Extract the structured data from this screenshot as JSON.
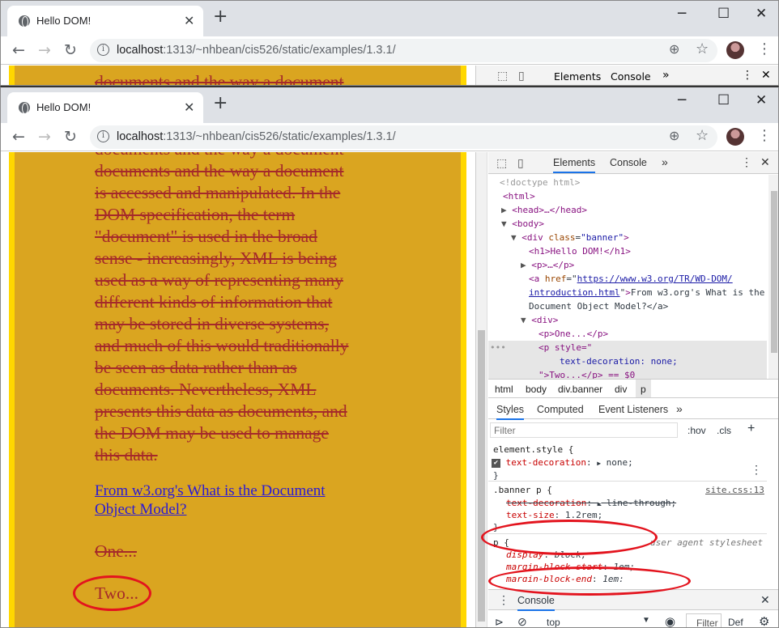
{
  "tab_title": "Hello DOM!",
  "url_host": "localhost",
  "url_rest": ":1313/~nhbean/cis526/static/examples/1.3.1/",
  "page": {
    "partial_top_line": "documents and the way a document",
    "para_lines": [
      "documents and the way a document",
      "is accessed and manipulated. In the",
      "DOM specification, the term",
      "\"document\" is used in the broad",
      "sense - increasingly, XML is being",
      "used as a way of representing many",
      "different kinds of information that",
      "may be stored in diverse systems,",
      "and much of this would traditionally",
      "be seen as data rather than as",
      "documents. Nevertheless, XML",
      "presents this data as documents, and",
      "the DOM may be used to manage",
      "this data."
    ],
    "link_line1": "From w3.org's What is the Document",
    "link_line2": "Object Model?",
    "one": "One...",
    "two": "Two..."
  },
  "devtools": {
    "tabs": [
      "Elements",
      "Console"
    ],
    "more": "»",
    "dom": {
      "doctype": "<!doctype html>",
      "html_open": "<html>",
      "head": "<head>…</head>",
      "body_open": "<body>",
      "div_tag": "<div ",
      "div_attr": "class",
      "div_val": "\"banner\"",
      "h1": "<h1>Hello DOM!</h1>",
      "p_collapsed": "<p>…</p>",
      "a_tag": "<a ",
      "a_attr": "href",
      "a_href1": "https://www.w3.org/TR/WD-DOM/",
      "a_href2": "introduction.html",
      "a_text1": "From w3.org's What is the",
      "a_text2": "Document Object Model?</a>",
      "div2": "<div>",
      "p_one": "<p>One...</p>",
      "p_style": "<p style=\"",
      "p_style_val": "text-decoration: none;",
      "p_two": "\">Two...</p> == $0"
    },
    "crumbs": [
      "html",
      "body",
      "div.banner",
      "div",
      "p"
    ],
    "style_tabs": [
      "Styles",
      "Computed",
      "Event Listeners"
    ],
    "filter_placeholder": "Filter",
    "hov": ":hov",
    "cls": ".cls",
    "plus": "+",
    "rules": {
      "element_style": "element.style {",
      "td_prop": "text-decoration",
      "td_val": "none;",
      "close": "}",
      "banner_sel": ".banner p {",
      "banner_src": "site.css:13",
      "lt_prop": "text-decoration",
      "lt_val": "line-through;",
      "ts_prop": "text-size",
      "ts_val": "1.2rem;",
      "p_sel": "p {",
      "ua": "user agent stylesheet",
      "display_prop": "display",
      "display_val": "block;",
      "mbs_prop": "margin-block-start",
      "mbs_val": "1em;",
      "mbe_prop": "margin-block-end",
      "mbe_val": "1em;"
    },
    "console_tab": "Console",
    "console_top": "top",
    "console_filter": "Filter",
    "console_def": "Def"
  },
  "colors": {
    "banner_bg": "#daa520",
    "banner_border": "#ffd700",
    "text": "#a52a2a",
    "annotation": "#e3141e"
  }
}
